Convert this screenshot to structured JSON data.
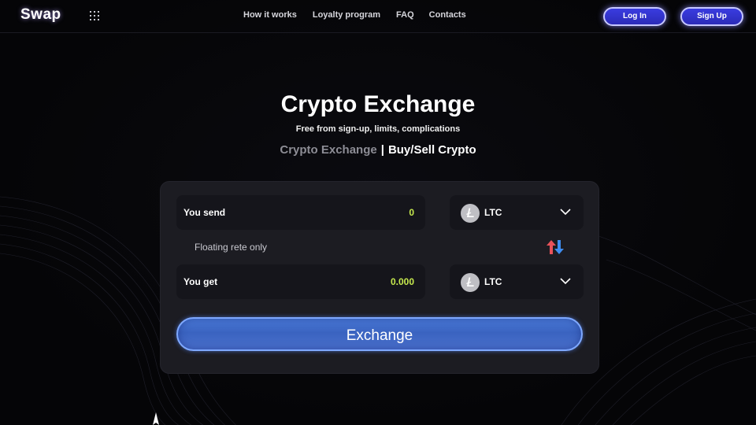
{
  "header": {
    "logo": "Swap",
    "nav": [
      "How it works",
      "Loyalty program",
      "FAQ",
      "Contacts"
    ],
    "login_label": "Log In",
    "signup_label": "Sign Up"
  },
  "hero": {
    "title": "Crypto Exchange",
    "subtitle": "Free from sign-up, limits, complications",
    "tab_inactive": "Crypto Exchange",
    "tab_separator": "|",
    "tab_active": "Buy/Sell Crypto"
  },
  "exchange": {
    "send_label": "You send",
    "send_value": "0",
    "send_coin": "LTC",
    "rate_note": "Floating rete only",
    "get_label": "You get",
    "get_value": "0.000",
    "get_coin": "LTC",
    "submit_label": "Exchange"
  },
  "icons": {
    "menu": "grid-icon",
    "coin": "litecoin-icon",
    "dropdown": "chevron-down-icon",
    "swap": "swap-arrows-icon"
  },
  "colors": {
    "background": "#050507",
    "card": "#1c1c22",
    "amount": "#c6e94e",
    "accent_button": "#3a63c0",
    "auth_button": "#2b2bb8"
  }
}
